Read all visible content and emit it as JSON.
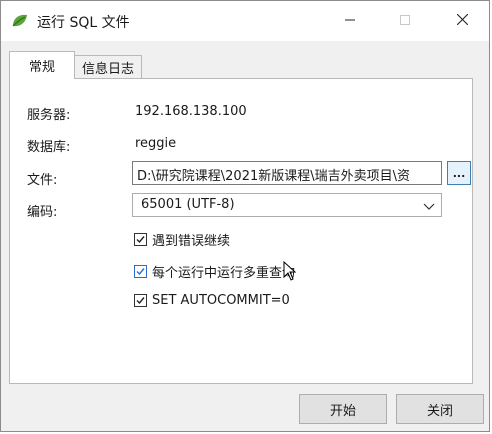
{
  "window": {
    "title": "运行 SQL 文件",
    "app_icon": "navicat-leaf-icon"
  },
  "window_controls": {
    "minimize": "minimize-icon",
    "maximize": "maximize-icon",
    "close": "close-icon"
  },
  "tabs": [
    {
      "label": "常规",
      "active": true
    },
    {
      "label": "信息日志",
      "active": false
    }
  ],
  "form": {
    "server_label": "服务器:",
    "server_value": "192.168.138.100",
    "database_label": "数据库:",
    "database_value": "reggie",
    "file_label": "文件:",
    "file_value": "D:\\研究院课程\\2021新版课程\\瑞吉外卖项目\\资",
    "browse_label": "...",
    "encoding_label": "编码:",
    "encoding_value": "65001 (UTF-8)"
  },
  "options": [
    {
      "label": "遇到错误继续",
      "checked": true
    },
    {
      "label": "每个运行中运行多重查询",
      "checked": true
    },
    {
      "label": "SET AUTOCOMMIT=0",
      "checked": true
    }
  ],
  "buttons": {
    "start": "开始",
    "close": "关闭"
  },
  "colors": {
    "accent": "#2a6fd0",
    "client_bg": "#f0f0f0",
    "panel_bg": "#ffffff",
    "leaf_green": "#4caf50"
  }
}
